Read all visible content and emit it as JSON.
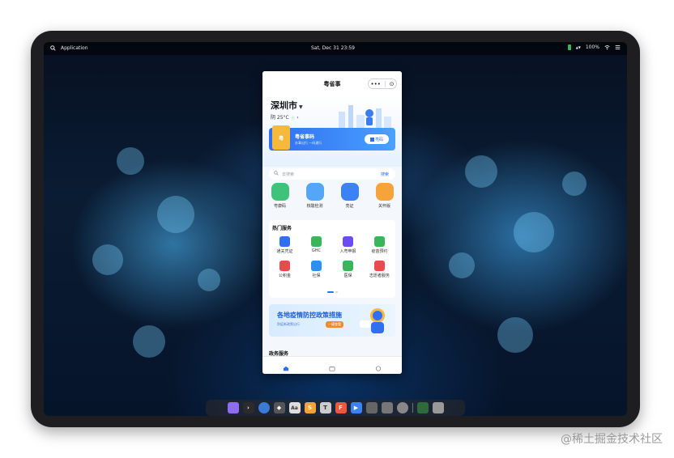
{
  "topbar": {
    "app_label": "Application",
    "datetime": "Sat, Dec 31   23:59",
    "battery": "100%"
  },
  "app": {
    "title": "粤省事",
    "capsule_more": "•••",
    "capsule_close": "⊙",
    "city": "深圳市",
    "weather": "阴 25°C",
    "banner_badge": "粤",
    "banner_title": "粤省事码",
    "banner_subtitle": "办事出行 一码通行",
    "banner_button": "亮码",
    "search_placeholder": "去搜索",
    "search_button": "搜索",
    "quick": [
      {
        "label": "粤康码",
        "color": "#3fc37a"
      },
      {
        "label": "核酸检测",
        "color": "#55a6f7"
      },
      {
        "label": "亮证",
        "color": "#3b82f6"
      },
      {
        "label": "关怀版",
        "color": "#f6a33b"
      }
    ],
    "hot_title": "热门服务",
    "hot": [
      {
        "label": "通关凭证",
        "color": "#2f6ff0"
      },
      {
        "label": "GHC",
        "color": "#3bb55a"
      },
      {
        "label": "入粤申报",
        "color": "#6a4cf0"
      },
      {
        "label": "疫苗预约",
        "color": "#3bb55a"
      },
      {
        "label": "公积金",
        "color": "#e84b4b"
      },
      {
        "label": "社保",
        "color": "#2f8ff0"
      },
      {
        "label": "医保",
        "color": "#3bb55a"
      },
      {
        "label": "志愿者服务",
        "color": "#e84b4b"
      }
    ],
    "promo_title": "各地疫情防控政策措施",
    "promo_subtitle": "防疫新政策出行",
    "promo_button": "一键查看",
    "section_peek": "政务服务",
    "tabs": [
      {
        "label": "首页"
      },
      {
        "label": "办事"
      },
      {
        "label": "我的"
      }
    ]
  },
  "dock": {
    "apps": [
      {
        "name": "a",
        "color": "#8e6cf0"
      },
      {
        "name": ">_",
        "color": "#2b2b2b"
      },
      {
        "name": "◉",
        "color": "#3a7bd5"
      },
      {
        "name": "◆",
        "color": "#555555"
      },
      {
        "name": "Aa",
        "color": "#dddddd"
      },
      {
        "name": "S",
        "color": "#f0a23b"
      },
      {
        "name": "T",
        "color": "#cccccc"
      },
      {
        "name": "F",
        "color": "#e85a3b"
      },
      {
        "name": "▶",
        "color": "#3b82f6"
      },
      {
        "name": "◈",
        "color": "#666666"
      },
      {
        "name": "▦",
        "color": "#777777"
      },
      {
        "name": "⚙",
        "color": "#888888"
      },
      {
        "name": "▤",
        "color": "#2f6a3b"
      },
      {
        "name": "🗑",
        "color": "#999999"
      }
    ]
  },
  "watermark": "@稀土掘金技术社区"
}
